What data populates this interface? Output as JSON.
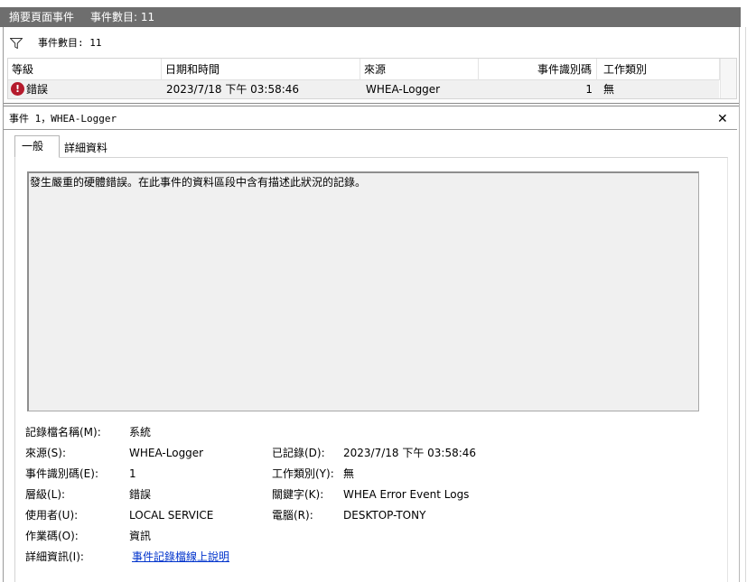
{
  "titlebar": {
    "title": "摘要頁面事件",
    "count": "事件數目: 11"
  },
  "filterbar": {
    "icon": "filter-funnel-icon",
    "count": "事件數目: 11"
  },
  "grid": {
    "columns": [
      "等級",
      "日期和時間",
      "來源",
      "事件識別碼",
      "工作類別"
    ],
    "rows": [
      {
        "level_icon": "error-icon",
        "level": "錯誤",
        "datetime": "2023/7/18 下午 03:58:46",
        "source": "WHEA-Logger",
        "event_id": "1",
        "task_category": "無"
      }
    ]
  },
  "detail": {
    "header": "事件 1，WHEA-Logger",
    "close_icon": "close-icon",
    "tabs": [
      "一般",
      "詳細資料"
    ],
    "description": "發生嚴重的硬體錯誤。在此事件的資料區段中含有描述此狀況的記錄。",
    "props": {
      "log_name_label": "記錄檔名稱(M):",
      "log_name": "系統",
      "source_label": "來源(S):",
      "source": "WHEA-Logger",
      "logged_label": "已記錄(D):",
      "logged": "2023/7/18 下午 03:58:46",
      "event_id_label": "事件識別碼(E):",
      "event_id": "1",
      "task_category_label": "工作類別(Y):",
      "task_category": "無",
      "level_label": "層級(L):",
      "level": "錯誤",
      "keywords_label": "關鍵字(K):",
      "keywords": "WHEA Error Event Logs",
      "user_label": "使用者(U):",
      "user": "LOCAL SERVICE",
      "computer_label": "電腦(R):",
      "computer": "DESKTOP-TONY",
      "opcode_label": "作業碼(O):",
      "opcode": "資訊",
      "more_info_label": "詳細資訊(I):",
      "more_info_link": "事件記錄檔線上說明"
    }
  }
}
